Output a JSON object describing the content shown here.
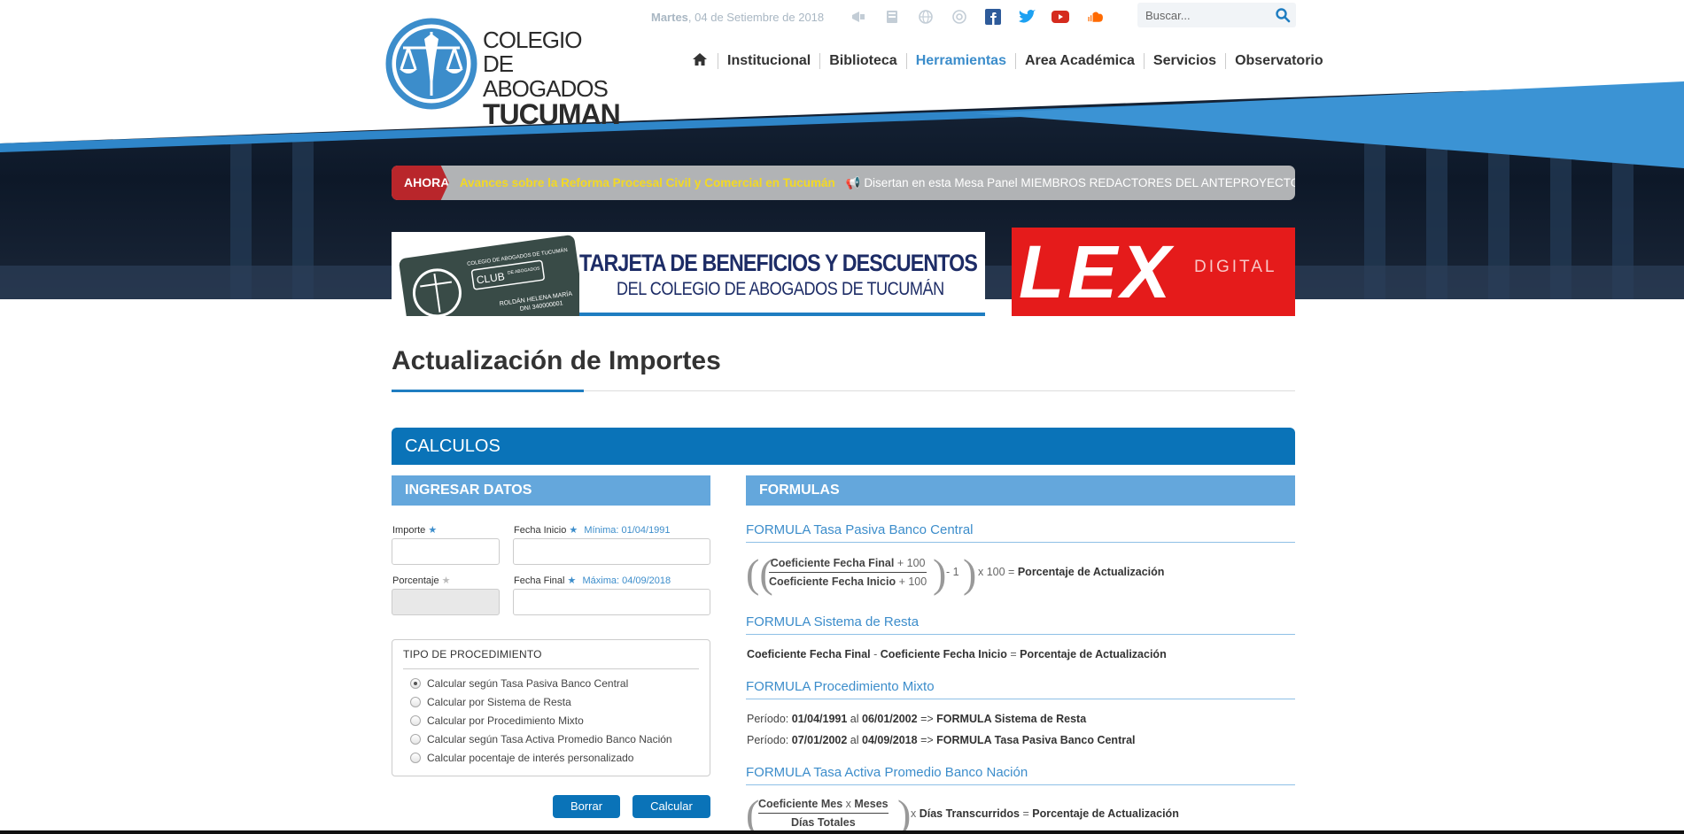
{
  "brand": {
    "line1": "COLEGIO",
    "line2": "DE ABOGADOS",
    "line3": "TUCUMAN"
  },
  "topbar": {
    "date_day": "Martes",
    "date_rest": ", 04 de Setiembre de 2018",
    "icons": [
      "megaphone-icon",
      "book-icon",
      "globe-icon",
      "at-icon",
      "facebook-icon",
      "twitter-icon",
      "youtube-icon",
      "soundcloud-icon"
    ],
    "search_placeholder": "Buscar..."
  },
  "nav": {
    "home_icon": "home-icon",
    "items": [
      "Institucional",
      "Biblioteca",
      "Herramientas",
      "Area Académica",
      "Servicios",
      "Observatorio"
    ],
    "active": "Herramientas"
  },
  "ticker": {
    "label": "AHORA",
    "headline": "Avances sobre la Reforma Procesal Civil y Comercial en Tucumán",
    "text": "Disertan en esta Mesa Panel MIEMBROS REDACTORES DEL ANTEPROYECTO DEL"
  },
  "banners": {
    "card_title": "TARJETA DE BENEFICIOS Y DESCUENTOS",
    "card_subtitle": "DEL COLEGIO DE ABOGADOS DE TUCUMÁN",
    "card_header": "COLEGIO DE ABOGADOS DE TUCUMÁN",
    "card_club": "CLUB",
    "card_de_abogados": "DE ABOGADOS",
    "card_name": "ROLDÁN HELENA MARÍA",
    "card_dni": "DNI 340000001",
    "lex_main": "LEX",
    "lex_sub": "DIGITAL"
  },
  "page": {
    "title": "Actualización de Importes",
    "section": "CALCULOS"
  },
  "form": {
    "heading": "INGRESAR DATOS",
    "importe_label": "Importe",
    "fecha_inicio_label": "Fecha Inicio",
    "fecha_inicio_hint": "Mínima: 01/04/1991",
    "porcentaje_label": "Porcentaje",
    "fecha_final_label": "Fecha Final",
    "fecha_final_hint": "Máxima: 04/09/2018",
    "importe_value": "",
    "fecha_inicio_value": "",
    "porcentaje_value": "",
    "fecha_final_value": "",
    "procedure_legend": "TIPO DE PROCEDIMIENTO",
    "options": [
      "Calcular según Tasa Pasiva Banco Central",
      "Calcular por Sistema de Resta",
      "Calcular por Procedimiento Mixto",
      "Calcular según Tasa Activa Promedio Banco Nación",
      "Calcular pocentaje de interés personalizado"
    ],
    "selected_option": "Calcular según Tasa Pasiva Banco Central",
    "btn_clear": "Borrar",
    "btn_calc": "Calcular"
  },
  "formulas": {
    "heading": "FORMULAS",
    "f1_title": "FORMULA Tasa Pasiva Banco Central",
    "f1_num_a": "Coeficiente Fecha Final",
    "f1_num_b": "+ 100",
    "f1_den_a": "Coeficiente Fecha Inicio",
    "f1_den_b": "+ 100",
    "f1_minus": "- 1",
    "f1_times": "x 100 =",
    "f1_result": "Porcentaje de Actualización",
    "f2_title": "FORMULA Sistema de Resta",
    "f2_a": "Coeficiente Fecha Final",
    "f2_op": "-",
    "f2_b": "Coeficiente Fecha Inicio",
    "f2_eq": "=",
    "f2_result": "Porcentaje de Actualización",
    "f3_title": "FORMULA Procedimiento Mixto",
    "f3_period_label": "Período:",
    "f3_al": "al",
    "f3_arrow": "=>",
    "f3_r1_from": "01/04/1991",
    "f3_r1_to": "06/01/2002",
    "f3_r1_formula": "FORMULA Sistema de Resta",
    "f3_r2_from": "07/01/2002",
    "f3_r2_to": "04/09/2018",
    "f3_r2_formula": "FORMULA Tasa Pasiva Banco Central",
    "f4_title": "FORMULA Tasa Activa Promedio Banco Nación",
    "f4_num_a": "Coeficiente Mes",
    "f4_num_x": "x",
    "f4_num_b": "Meses",
    "f4_den": "Días Totales",
    "f4_times": "x",
    "f4_days": "Días Transcurridos",
    "f4_eq": "=",
    "f4_result": "Porcentaje de Actualización"
  },
  "colors": {
    "primary": "#0a73b8",
    "light_blue": "#64a7dc",
    "link": "#3c8dcb",
    "ticker_red": "#b9262b",
    "ticker_headline": "#f3d923",
    "lex_red": "#e51b1b"
  }
}
